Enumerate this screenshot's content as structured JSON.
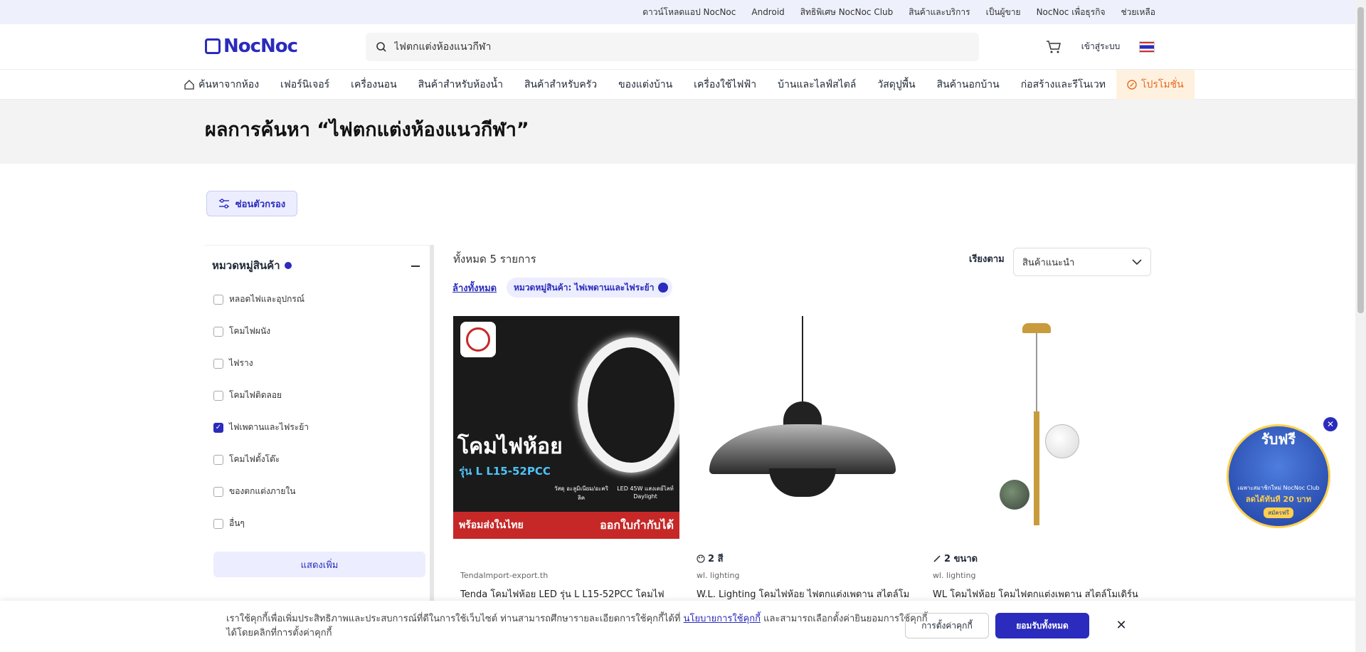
{
  "topbar": {
    "items": [
      "ดาวน์โหลดแอป NocNoc",
      "Android",
      "สิทธิพิเศษ NocNoc Club",
      "สินค้าและบริการ",
      "เป็นผู้ขาย",
      "NocNoc เพื่อธุรกิจ",
      "ช่วยเหลือ"
    ]
  },
  "header": {
    "logo": "NocNoc",
    "search_value": "ไฟตกแต่งห้องแนวกีฬา",
    "login_label": "เข้าสู่ระบบ"
  },
  "catnav": {
    "items": [
      "ค้นหาจากห้อง",
      "เฟอร์นิเจอร์",
      "เครื่องนอน",
      "สินค้าสำหรับห้องน้ำ",
      "สินค้าสำหรับครัว",
      "ของแต่งบ้าน",
      "เครื่องใช้ไฟฟ้า",
      "บ้านและไลฟ์สไตล์",
      "วัสดุปูพื้น",
      "สินค้านอกบ้าน",
      "ก่อสร้างและรีโนเวท",
      "โปรโมชั่น"
    ]
  },
  "title": "ผลการค้นหา “ไฟตกแต่งห้องแนวกีฬา”",
  "filter_toggle": "ซ่อนตัวกรอง",
  "sidebar": {
    "heading": "หมวดหมู่สินค้า",
    "categories": [
      {
        "label": "หลอดไฟและอุปกรณ์",
        "checked": false
      },
      {
        "label": "โคมไฟผนัง",
        "checked": false
      },
      {
        "label": "ไฟราง",
        "checked": false
      },
      {
        "label": "โคมไฟติดลอย",
        "checked": false
      },
      {
        "label": "ไฟเพดานและไฟระย้า",
        "checked": true
      },
      {
        "label": "โคมไฟตั้งโต๊ะ",
        "checked": false
      },
      {
        "label": "ของตกแต่งภายใน",
        "checked": false
      },
      {
        "label": "อื่นๆ",
        "checked": false
      }
    ],
    "show_more": "แสดงเพิ่ม"
  },
  "results": {
    "count_text": "ทั้งหมด 5 รายการ",
    "sort_label": "เรียงตาม",
    "sort_value": "สินค้าแนะนำ",
    "clear_all": "ล้างทั้งหมด",
    "active_filter": "หมวดหมู่สินค้า: ไฟเพดานและไฟระย้า"
  },
  "products": [
    {
      "variant": "",
      "brand": "TendaImport-export.th",
      "name": "Tenda โคมไฟห้อย LED รุ่น L L15-52PCC โคมไฟ",
      "image_text": {
        "title": "โคมไฟห้อย",
        "model": "รุ่น L L15-52PCC",
        "spec1": "วัสดุ อะลูมิเนียม/อะคริลิค",
        "spec2": "LED 45W แสงเดย์ไลท์ Daylight",
        "ship": "พร้อมส่งในไทย",
        "invoice": "ออกใบกำกับได้"
      }
    },
    {
      "variant": "2 สี",
      "brand": "wl. lighting",
      "name": "W.L. Lighting โคมไฟห้อย ไฟตกแต่งเพดาน สไตล์โม",
      "image_text": {}
    },
    {
      "variant": "2 ขนาด",
      "brand": "wl. lighting",
      "name": "WL โคมไฟห้อย โคมไฟตกแต่งเพดาน สไตล์โมเดิร์น",
      "image_text": {}
    }
  ],
  "promo_float": {
    "title": "รับฟรี",
    "line1": "เฉพาะสมาชิกใหม่ NocNoc Club",
    "line2": "ลดได้ทันที 20 บาท",
    "cta": "สมัครฟรี"
  },
  "cookie": {
    "text_before": "เราใช้คุกกี้เพื่อเพิ่มประสิทธิภาพและประสบการณ์ที่ดีในการใช้เว็บไซต์ ท่านสามารถศึกษารายละเอียดการใช้คุกกี้ได้ที่ ",
    "link": "นโยบายการใช้คุกกี้",
    "text_after": " และสามารถเลือกตั้งค่ายินยอมการใช้คุกกี้ได้โดยคลิกที่การตั้งค่าคุกกี้",
    "settings_label": "การตั้งค่าคุกกี้",
    "accept_label": "ยอมรับทั้งหมด"
  },
  "colors": {
    "brand": "#2b2bbd",
    "promo": "#e86a1e"
  }
}
